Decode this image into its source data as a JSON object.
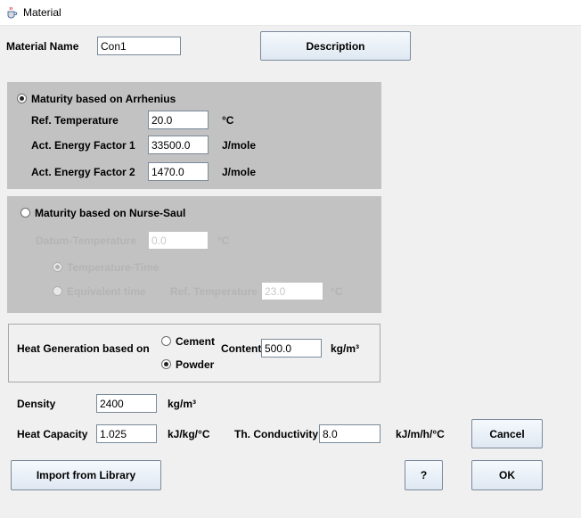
{
  "window": {
    "title": "Material"
  },
  "material_name": {
    "label": "Material Name",
    "value": "Con1"
  },
  "description_button": "Description",
  "arrhenius": {
    "label": "Maturity based on Arrhenius",
    "selected": true,
    "ref_temp": {
      "label": "Ref. Temperature",
      "value": "20.0",
      "unit": "°C"
    },
    "energy1": {
      "label": "Act. Energy Factor 1",
      "value": "33500.0",
      "unit": "J/mole"
    },
    "energy2": {
      "label": "Act. Energy Factor 2",
      "value": "1470.0",
      "unit": "J/mole"
    }
  },
  "nurse_saul": {
    "label": "Maturity based on Nurse-Saul",
    "selected": false,
    "datum": {
      "label": "Datum-Temperature",
      "value": "0.0",
      "unit": "°C"
    },
    "temp_time_label": "Temperature-Time",
    "equiv_time_label": "Equivalent time",
    "ref_temp": {
      "label": "Ref. Temperature",
      "value": "23.0",
      "unit": "°C"
    }
  },
  "heat_generation": {
    "label": "Heat Generation based on",
    "cement_label": "Cement",
    "powder_label": "Powder",
    "selected": "Powder",
    "content_label": "Content",
    "content_value": "500.0",
    "content_unit": "kg/m³"
  },
  "density": {
    "label": "Density",
    "value": "2400",
    "unit": "kg/m³"
  },
  "heat_capacity": {
    "label": "Heat Capacity",
    "value": "1.025",
    "unit": "kJ/kg/°C"
  },
  "conductivity": {
    "label": "Th. Conductivity",
    "value": "8.0",
    "unit": "kJ/m/h/°C"
  },
  "buttons": {
    "cancel": "Cancel",
    "import": "Import from Library",
    "help": "?",
    "ok": "OK"
  },
  "icons": {
    "window": "java-cup-icon"
  }
}
